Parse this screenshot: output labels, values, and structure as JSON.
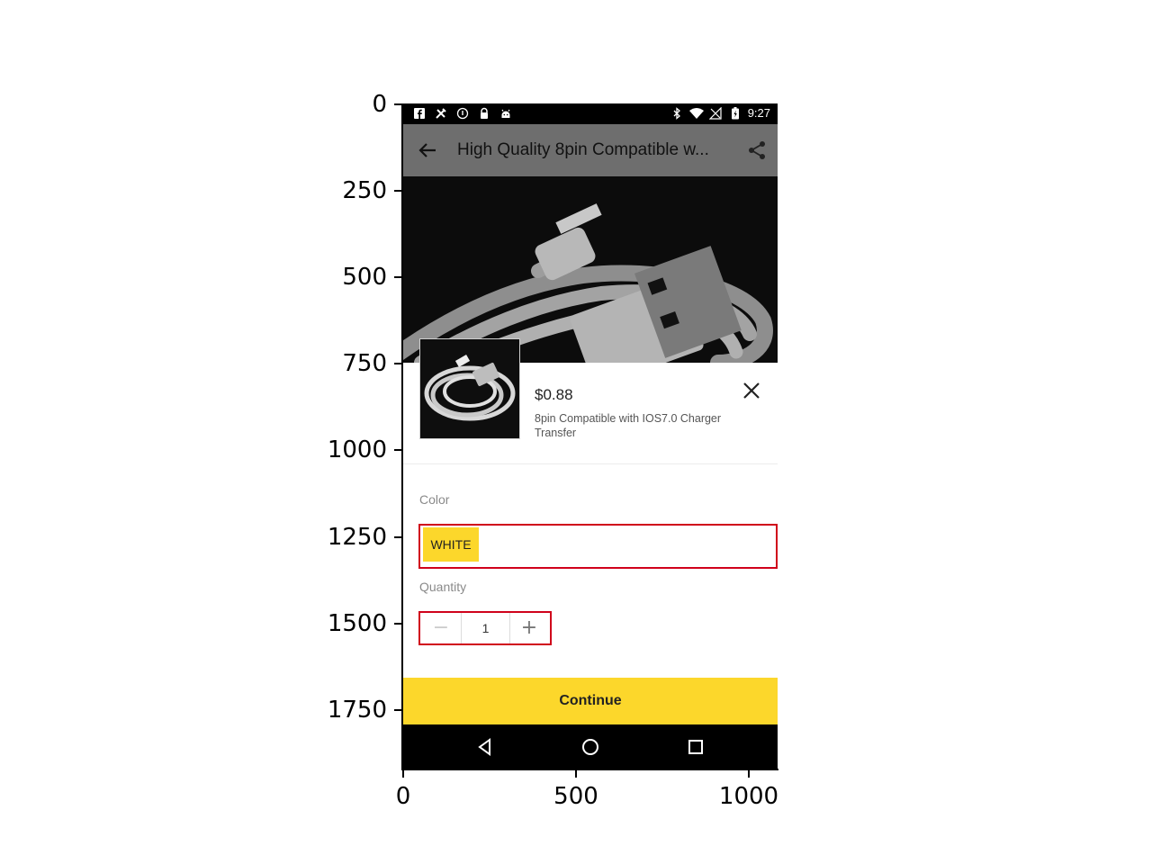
{
  "axes": {
    "y_ticks": [
      "0",
      "250",
      "500",
      "750",
      "1000",
      "1250",
      "1500",
      "1750"
    ],
    "x_ticks": [
      "0",
      "500",
      "1000"
    ]
  },
  "status_bar": {
    "time": "9:27",
    "left_icons": [
      "facebook-icon",
      "tools-icon",
      "circle-info-icon",
      "lock-icon",
      "android-icon"
    ],
    "right_icons": [
      "bluetooth-icon",
      "wifi-icon",
      "no-signal-icon",
      "battery-charging-icon"
    ]
  },
  "app_bar": {
    "title": "High Quality  8pin Compatible w..."
  },
  "sheet": {
    "price": "$0.88",
    "product_name": "8pin Compatible with IOS7.0 Charger Transfer",
    "color_label": "Color",
    "color_option": "WHITE",
    "quantity_label": "Quantity",
    "quantity_value": "1",
    "minus": "−",
    "plus": "+",
    "continue_label": "Continue"
  },
  "colors": {
    "accent": "#fcd72b",
    "highlight_border": "#d0021b",
    "app_bar": "#6e6e6e"
  }
}
